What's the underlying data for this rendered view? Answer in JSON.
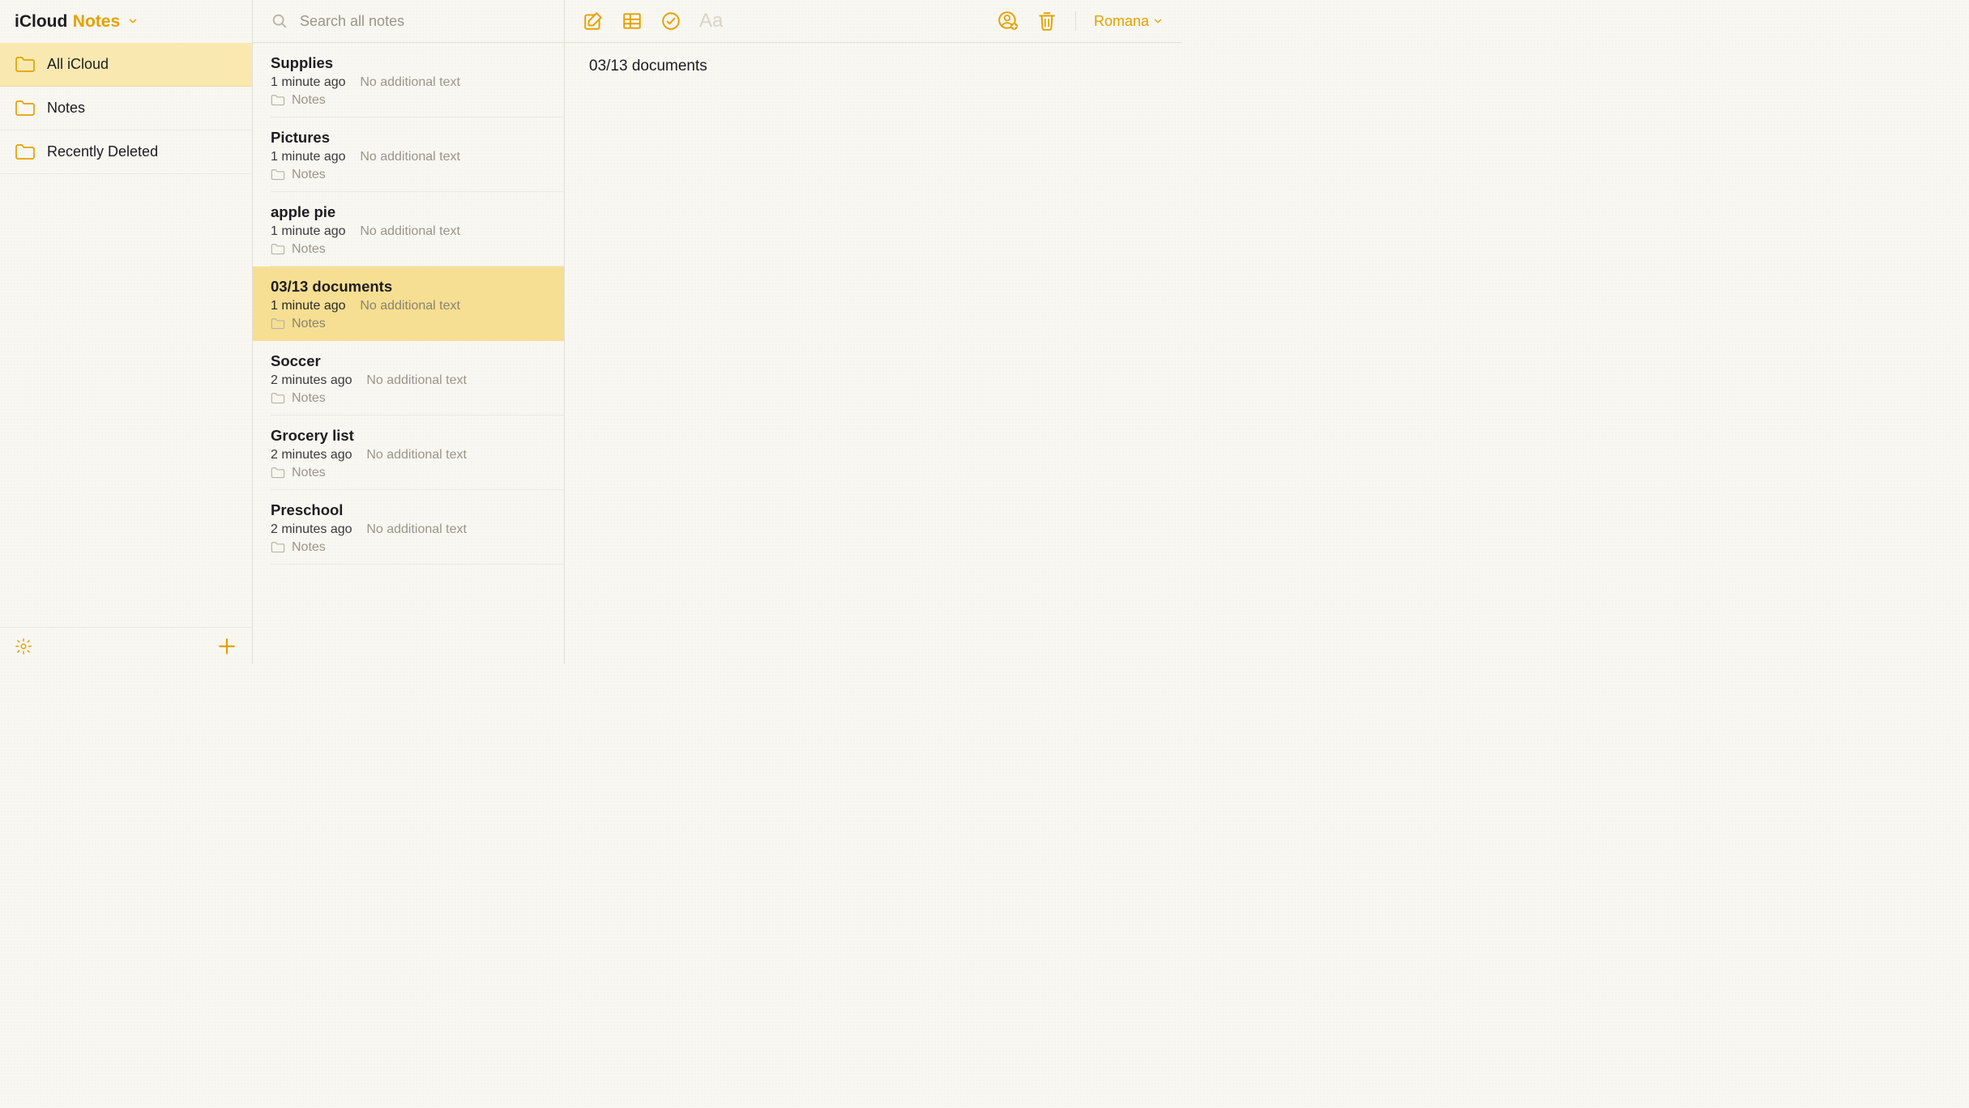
{
  "brand": {
    "service": "iCloud",
    "app": "Notes"
  },
  "search": {
    "placeholder": "Search all notes"
  },
  "user": {
    "name": "Romana"
  },
  "sidebar": {
    "folders": [
      {
        "label": "All iCloud",
        "selected": true
      },
      {
        "label": "Notes",
        "selected": false
      },
      {
        "label": "Recently Deleted",
        "selected": false
      }
    ]
  },
  "notes": [
    {
      "title": "Supplies",
      "time": "1 minute ago",
      "snippet": "No additional text",
      "folder": "Notes",
      "selected": false
    },
    {
      "title": "Pictures",
      "time": "1 minute ago",
      "snippet": "No additional text",
      "folder": "Notes",
      "selected": false
    },
    {
      "title": "apple pie",
      "time": "1 minute ago",
      "snippet": "No additional text",
      "folder": "Notes",
      "selected": false
    },
    {
      "title": "03/13 documents",
      "time": "1 minute ago",
      "snippet": "No additional text",
      "folder": "Notes",
      "selected": true
    },
    {
      "title": "Soccer",
      "time": "2 minutes ago",
      "snippet": "No additional text",
      "folder": "Notes",
      "selected": false
    },
    {
      "title": "Grocery list",
      "time": "2 minutes ago",
      "snippet": "No additional text",
      "folder": "Notes",
      "selected": false
    },
    {
      "title": "Preschool",
      "time": "2 minutes ago",
      "snippet": "No additional text",
      "folder": "Notes",
      "selected": false
    }
  ],
  "editor": {
    "body": "03/13 documents"
  }
}
